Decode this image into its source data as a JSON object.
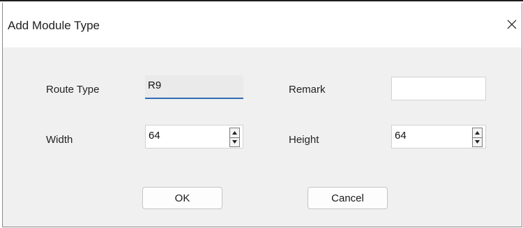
{
  "dialog": {
    "title": "Add Module Type",
    "close_icon": "close-icon"
  },
  "form": {
    "route_type": {
      "label": "Route Type",
      "value": "R9"
    },
    "remark": {
      "label": "Remark",
      "value": ""
    },
    "width": {
      "label": "Width",
      "value": "64"
    },
    "height": {
      "label": "Height",
      "value": "64"
    }
  },
  "buttons": {
    "ok_label": "OK",
    "cancel_label": "Cancel"
  },
  "colors": {
    "focus_underline": "#2f6db5",
    "dialog_background": "#f0f0f0"
  }
}
